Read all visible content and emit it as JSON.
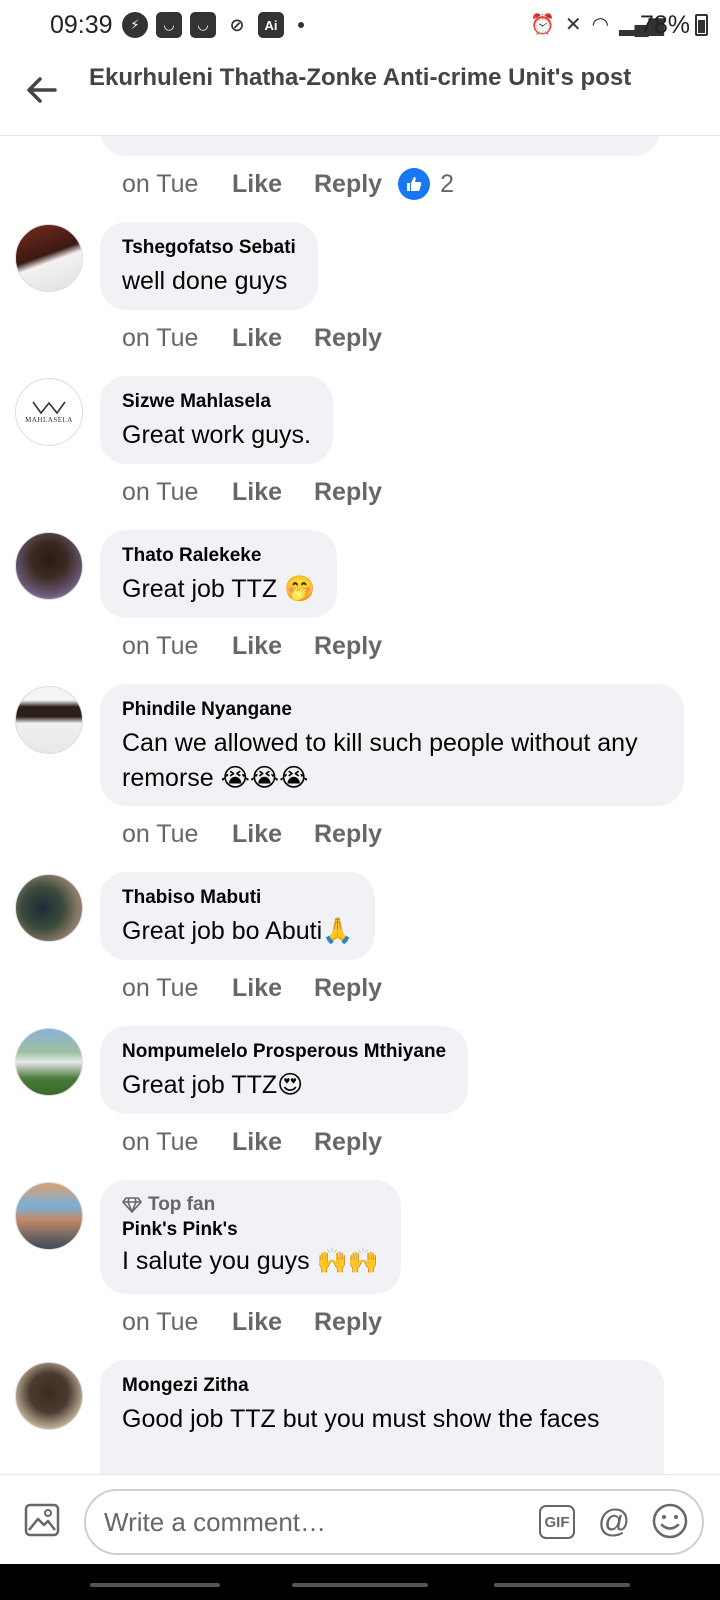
{
  "status_bar": {
    "time": "09:39",
    "left_icons": [
      "bolt-icon",
      "bag-icon",
      "bag-icon",
      "mute-icon",
      "ai-icon",
      "dot-icon"
    ],
    "ai_label": "Ai",
    "battery": "78%"
  },
  "header": {
    "title": "Ekurhuleni Thatha-Zonke Anti-crime Unit's post"
  },
  "partial_comment": {
    "time": "on Tue",
    "like": "Like",
    "reply": "Reply",
    "reaction_count": "2"
  },
  "comments": [
    {
      "author": "Tshegofatso Sebati",
      "text": "well done guys",
      "emoji": "",
      "time": "on Tue",
      "like": "Like",
      "reply": "Reply"
    },
    {
      "author": "Sizwe Mahlasela",
      "text": "Great work guys.",
      "emoji": "",
      "time": "on Tue",
      "like": "Like",
      "reply": "Reply",
      "avatar_text": "MAHLASELA"
    },
    {
      "author": "Thato Ralekeke",
      "text": "Great job TTZ ",
      "emoji": "🤭",
      "time": "on Tue",
      "like": "Like",
      "reply": "Reply"
    },
    {
      "author": "Phindile Nyangane",
      "text": "Can we allowed to kill such people without any remorse ",
      "emoji": "😭😭😭",
      "time": "on Tue",
      "like": "Like",
      "reply": "Reply"
    },
    {
      "author": "Thabiso Mabuti",
      "text": "Great job bo Abuti",
      "emoji": "🙏",
      "time": "on Tue",
      "like": "Like",
      "reply": "Reply"
    },
    {
      "author": "Nompumelelo Prosperous Mthiyane",
      "text": "Great job TTZ",
      "emoji": "😍",
      "time": "on Tue",
      "like": "Like",
      "reply": "Reply"
    },
    {
      "author": "Pink's Pink's",
      "badge": "Top fan",
      "text": "I salute you guys ",
      "emoji": "🙌🙌",
      "time": "on Tue",
      "like": "Like",
      "reply": "Reply"
    },
    {
      "author": "Mongezi Zitha",
      "text": "Good job TTZ but you must show the faces",
      "emoji": ""
    }
  ],
  "composer": {
    "placeholder": "Write a comment…",
    "gif_label": "GIF",
    "at_label": "@"
  },
  "colors": {
    "accent": "#1877f2",
    "bubble": "#f0f2f5",
    "secondary_text": "#65676b"
  }
}
